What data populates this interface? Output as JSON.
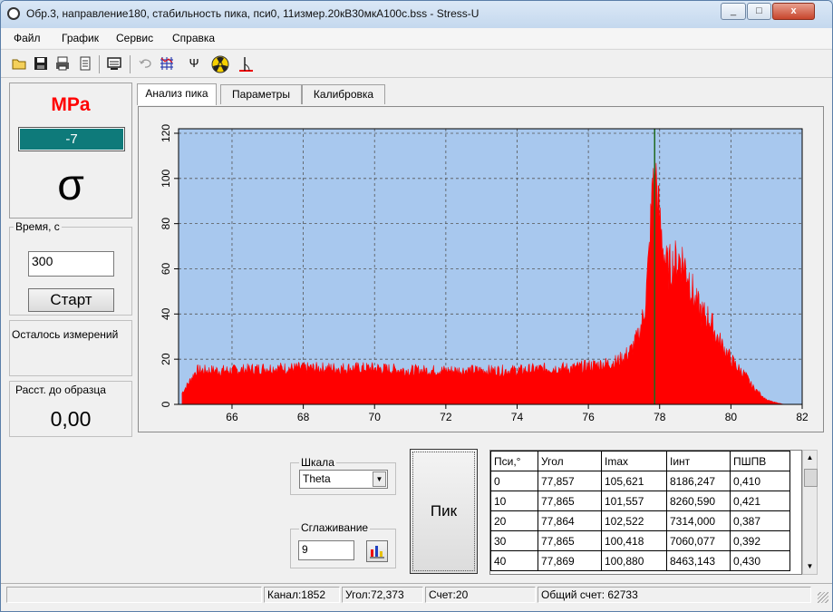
{
  "window": {
    "title": "Обр.3, направление180, стабильность пика, пси0, 11измер.20кВ30мкА100с.bss - Stress-U",
    "controls": [
      "_",
      "□",
      "x"
    ]
  },
  "menu": [
    "Файл",
    "График",
    "Сервис",
    "Справка"
  ],
  "toolbar": {
    "icons": [
      "open-folder-icon",
      "save-icon",
      "print-icon",
      "clipboard-icon",
      "screen-icon",
      "undo-icon",
      "grid-icon",
      "psi-icon",
      "radiation-icon",
      "angle-icon"
    ],
    "psi_glyph": "Ψ"
  },
  "stress": {
    "unit": "MPa",
    "value": "-7",
    "symbol": "σ"
  },
  "time_group": {
    "label": "Время, с",
    "value": "300",
    "start_button": "Старт"
  },
  "remaining_label": "Осталось измерений",
  "distance": {
    "label": "Расст. до образца",
    "value": "0,00"
  },
  "tabs": [
    {
      "label": "Анализ пика",
      "active": true
    },
    {
      "label": "Параметры",
      "active": false
    },
    {
      "label": "Калибровка",
      "active": false
    }
  ],
  "scale": {
    "label": "Шкала",
    "selected": "Theta"
  },
  "smoothing": {
    "label": "Сглаживание",
    "value": "9"
  },
  "peak_button": "Пик",
  "results_table": {
    "columns": [
      "Пси,°",
      "Угол",
      "Imax",
      "Iинт",
      "ПШПВ"
    ],
    "rows": [
      [
        "0",
        "77,857",
        "105,621",
        "8186,247",
        "0,410"
      ],
      [
        "10",
        "77,865",
        "101,557",
        "8260,590",
        "0,421"
      ],
      [
        "20",
        "77,864",
        "102,522",
        "7314,000",
        "0,387"
      ],
      [
        "30",
        "77,865",
        "100,418",
        "7060,077",
        "0,392"
      ],
      [
        "40",
        "77,869",
        "100,880",
        "8463,143",
        "0,430"
      ]
    ]
  },
  "status": {
    "channel": "Канал:1852",
    "angle": "Угол:72,373",
    "count": "Счет:20",
    "total": "Общий счет: 62733"
  },
  "colors": {
    "plot_background": "#a8c8ee",
    "histogram_fill": "#ff0000",
    "marker_line": "#1f6b1f",
    "stress_unit": "#ff0000",
    "value_box": "#0e7a7a"
  },
  "chart_data": {
    "type": "area",
    "title": "",
    "xlabel": "",
    "ylabel": "",
    "xlim": [
      64.5,
      82
    ],
    "ylim": [
      0,
      122
    ],
    "x_ticks": [
      66,
      68,
      70,
      72,
      74,
      76,
      78,
      80,
      82
    ],
    "y_ticks": [
      0,
      20,
      40,
      60,
      80,
      100,
      120
    ],
    "grid": true,
    "marker_x": 77.86,
    "series": [
      {
        "x": [
          64.6,
          65.0,
          66.0,
          67.0,
          68.0,
          69.0,
          70.0,
          71.0,
          72.0,
          73.0,
          74.0,
          75.0,
          75.5,
          76.0,
          76.5,
          76.8,
          77.0,
          77.2,
          77.4,
          77.5,
          77.6,
          77.7,
          77.8,
          77.85,
          77.9,
          78.0,
          78.2,
          78.4,
          78.6,
          78.8,
          79.0,
          79.2,
          79.4,
          79.6,
          79.8,
          80.0,
          80.2,
          80.4,
          80.6,
          80.8,
          81.0,
          81.2,
          81.5,
          82.0
        ],
        "values": [
          5,
          15,
          15,
          16,
          16,
          16,
          16,
          15,
          15,
          15,
          15,
          16,
          16,
          17,
          18,
          19,
          21,
          24,
          30,
          36,
          45,
          65,
          95,
          110,
          100,
          80,
          60,
          62,
          65,
          58,
          45,
          40,
          38,
          30,
          25,
          20,
          16,
          13,
          8,
          5,
          2,
          1,
          0,
          0
        ]
      }
    ]
  }
}
